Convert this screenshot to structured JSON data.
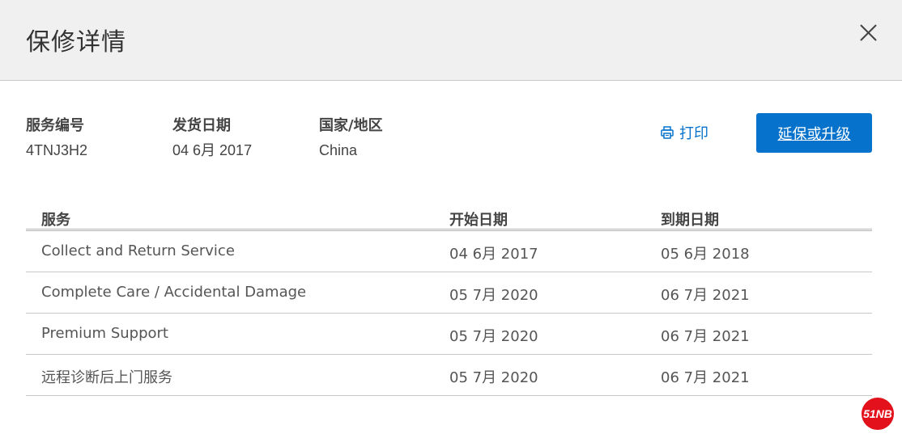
{
  "dialog": {
    "title": "保修详情"
  },
  "info": {
    "service_tag_label": "服务编号",
    "service_tag_value": "4TNJ3H2",
    "ship_date_label": "发货日期",
    "ship_date_value": "04 6月 2017",
    "country_label": "国家/地区",
    "country_value": "China"
  },
  "actions": {
    "print_label": "打印",
    "extend_label": "延保或升级"
  },
  "table": {
    "headers": [
      "服务",
      "开始日期",
      "到期日期"
    ],
    "rows": [
      [
        "Collect and Return Service",
        "04 6月 2017",
        "05 6月 2018"
      ],
      [
        "Complete Care / Accidental Damage",
        "05 7月 2020",
        "06 7月 2021"
      ],
      [
        "Premium Support",
        "05 7月 2020",
        "06 7月 2021"
      ],
      [
        "远程诊断后上门服务",
        "05 7月 2020",
        "06 7月 2021"
      ]
    ]
  },
  "watermark": {
    "text": "51NB"
  },
  "colors": {
    "accent": "#0672cb",
    "header_bg": "#f0f0f0",
    "logo_red": "#e3111b"
  }
}
